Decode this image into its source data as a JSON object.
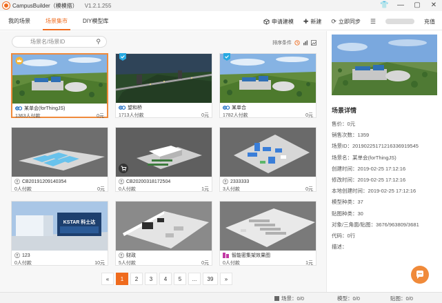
{
  "app": {
    "title": "CampusBuilder（模模搭）",
    "version": "V1.2.1.255"
  },
  "window_controls": [
    "👕",
    "—",
    "▢",
    "✕"
  ],
  "tabs": [
    {
      "label": "我的场景",
      "active": false
    },
    {
      "label": "场景集市",
      "active": true
    },
    {
      "label": "DIY模型库",
      "active": false
    }
  ],
  "actions": {
    "apply_model": "申请建模",
    "new": "新建",
    "sync": "立即同步",
    "menu": "☰",
    "recharge": "充值"
  },
  "search": {
    "placeholder": "场景名/场景ID"
  },
  "sort": {
    "label": "排序条件"
  },
  "cards": [
    {
      "name": "某单会(forThingJS)",
      "paid": "1363人付款",
      "price": "0元",
      "owner": "logo",
      "badge": "crown",
      "selected": true,
      "scene": "campus"
    },
    {
      "name": "望和桥",
      "paid": "1713人付款",
      "price": "0元",
      "owner": "logo",
      "badge": "shield",
      "selected": false,
      "scene": "night"
    },
    {
      "name": "某单合",
      "paid": "1782人付款",
      "price": "0元",
      "owner": "logo",
      "badge": "shield",
      "selected": false,
      "scene": "campus2"
    },
    {
      "name": "CB20191209140354",
      "paid": "0人付款",
      "price": "0元",
      "owner": "avatar",
      "badge": "",
      "selected": false,
      "scene": "pool"
    },
    {
      "name": "CB20200318172504",
      "paid": "0人付款",
      "price": "1元",
      "owner": "avatar",
      "badge": "",
      "selected": false,
      "scene": "building",
      "cart": true
    },
    {
      "name": "2333333",
      "paid": "3人付款",
      "price": "0元",
      "owner": "avatar",
      "badge": "",
      "selected": false,
      "scene": "room"
    },
    {
      "name": "123",
      "paid": "0人付款",
      "price": "10元",
      "owner": "avatar",
      "badge": "",
      "selected": false,
      "scene": "kstar"
    },
    {
      "name": "财政",
      "paid": "5人付款",
      "price": "0元",
      "owner": "avatar",
      "badge": "",
      "selected": false,
      "scene": "office"
    },
    {
      "name": "智能密集架效果图",
      "paid": "0人付款",
      "price": "1元",
      "owner": "logo2",
      "badge": "",
      "selected": false,
      "scene": "shelf"
    }
  ],
  "kstar_label": "KSTAR 科士达",
  "pagination": [
    "«",
    "1",
    "2",
    "3",
    "4",
    "5",
    "...",
    "39",
    "»"
  ],
  "detail": {
    "title": "场景详情",
    "rows": [
      {
        "label": "售价：",
        "value": "0元"
      },
      {
        "label": "销售次数：",
        "value": "1359"
      },
      {
        "label": "场景ID：",
        "value": "20190225171216336919545"
      },
      {
        "label": "场景名：",
        "value": "某单会(forThingJS)"
      },
      {
        "label": "创建时间：",
        "value": "2019-02-25 17:12:16"
      },
      {
        "label": "修改时间：",
        "value": "2019-02-25 17:12:16"
      },
      {
        "label": "本地创建时间：",
        "value": "2019-02-25 17:12:16"
      },
      {
        "label": "模型种类：",
        "value": "37"
      },
      {
        "label": "贴图种类：",
        "value": "30"
      },
      {
        "label": "对象/三角面/贴图：",
        "value": "3676/963809/3681"
      },
      {
        "label": "代码：",
        "value": "0行"
      },
      {
        "label": "描述：",
        "value": ""
      }
    ]
  },
  "status": {
    "scene": "场景：0/0",
    "model": "模型：0/0",
    "texture": "贴图：0/0"
  },
  "colors": {
    "accent": "#ef6b1e"
  }
}
